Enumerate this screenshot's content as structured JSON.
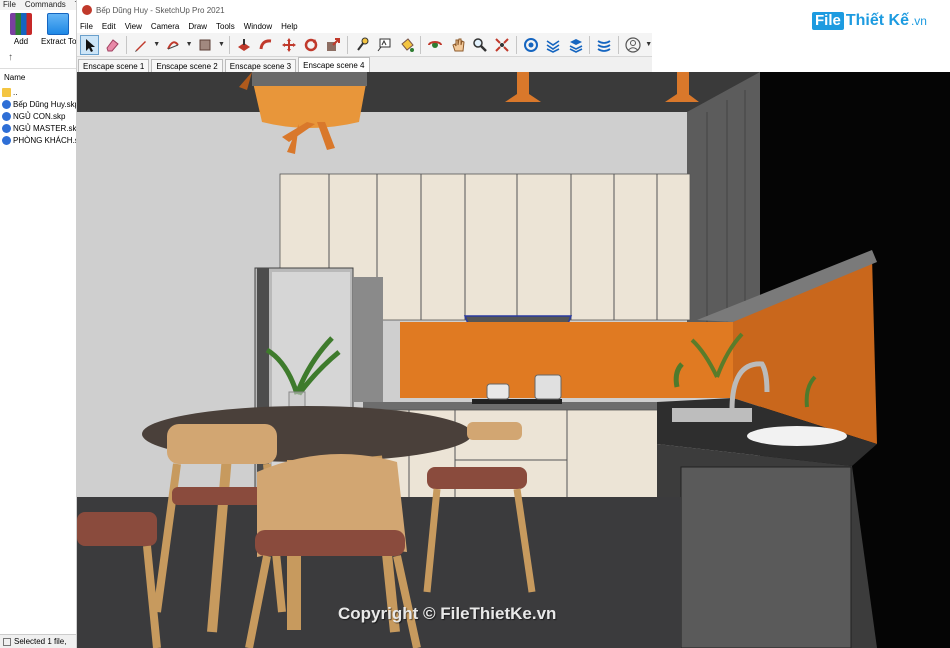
{
  "file_manager": {
    "menu": [
      "File",
      "Commands",
      "T"
    ],
    "tools": [
      {
        "label": "Add",
        "icon": "add-archive-icon"
      },
      {
        "label": "Extract To",
        "icon": "extract-to-icon"
      }
    ],
    "up_glyph": "↑",
    "column_header": "Name",
    "files": [
      {
        "name": "..",
        "icon": "parent-folder-icon"
      },
      {
        "name": "Bếp Dũng Huy.skp",
        "icon": "sketchup-file-icon"
      },
      {
        "name": "NGỦ CON.skp",
        "icon": "sketchup-file-icon"
      },
      {
        "name": "NGỦ MASTER.skp",
        "icon": "sketchup-file-icon"
      },
      {
        "name": "PHÒNG KHÁCH.skp",
        "icon": "sketchup-file-icon"
      }
    ],
    "status": "Selected 1 file, "
  },
  "sketchup": {
    "title": "Bếp Dũng Huy - SketchUp Pro 2021",
    "menu": [
      "File",
      "Edit",
      "View",
      "Camera",
      "Draw",
      "Tools",
      "Window",
      "Help"
    ],
    "toolbar": [
      {
        "name": "select-tool",
        "active": true
      },
      {
        "name": "eraser-tool"
      },
      {
        "name": "pencil-tool",
        "dropdown": true
      },
      {
        "name": "arc-tool",
        "dropdown": true
      },
      {
        "name": "rectangle-tool",
        "dropdown": true
      },
      {
        "name": "push-pull-tool"
      },
      {
        "name": "follow-me-tool"
      },
      {
        "name": "move-tool"
      },
      {
        "name": "rotate-tool"
      },
      {
        "name": "scale-tool"
      },
      {
        "name": "tape-measure-tool"
      },
      {
        "name": "text-tool"
      },
      {
        "name": "paint-bucket-tool"
      },
      {
        "name": "orbit-tool"
      },
      {
        "name": "pan-tool"
      },
      {
        "name": "zoom-tool"
      },
      {
        "name": "zoom-extents-tool"
      },
      {
        "name": "warehouse-tool"
      },
      {
        "name": "extension-warehouse-tool"
      },
      {
        "name": "layout-tool"
      },
      {
        "name": "trimble-connect-tool"
      },
      {
        "name": "account-tool",
        "dropdown": true
      }
    ],
    "scene_tabs": [
      {
        "label": "Enscape scene 1"
      },
      {
        "label": "Enscape scene 2"
      },
      {
        "label": "Enscape scene 3"
      },
      {
        "label": "Enscape scene 4",
        "active": true
      }
    ]
  },
  "watermark": {
    "brand_box": "File",
    "brand_text": "Thiết Kế",
    "brand_suffix": ".vn",
    "copyright": "Copyright © FileThietKe.vn",
    "brand_color": "#1d9be0"
  },
  "colors": {
    "backsplash": "#e07a22",
    "cabinet": "#ece4d6",
    "floor": "#3b3b3d",
    "wall": "#cfcfcf"
  }
}
